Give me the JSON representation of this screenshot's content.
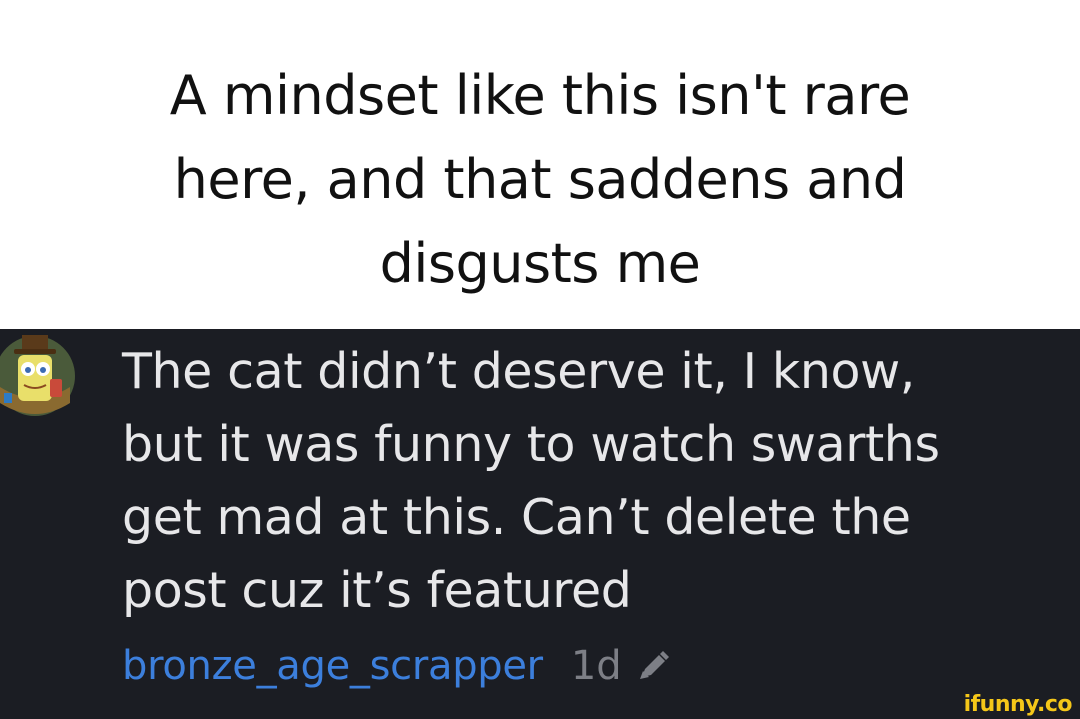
{
  "caption": {
    "lines": [
      "A mindset like this isn't rare",
      "here, and that saddens and",
      "disgusts me"
    ]
  },
  "comment": {
    "avatar_icon": "spongebob-avatar-icon",
    "text_lines": [
      "The cat didn’t deserve it, I know,",
      "but it was funny to watch swarths",
      "get mad at this. Can’t delete the",
      "post cuz it’s featured"
    ],
    "username": "bronze_age_scrapper",
    "time": "1d",
    "edited_icon": "pencil-icon"
  },
  "watermark": {
    "text": "ifunny.co"
  },
  "colors": {
    "caption_background": "#ffffff",
    "comment_background": "#1b1d23",
    "comment_text": "#e7e7e9",
    "username": "#3c7fdc",
    "time": "#7d7f86",
    "watermark": "#f5c719"
  }
}
